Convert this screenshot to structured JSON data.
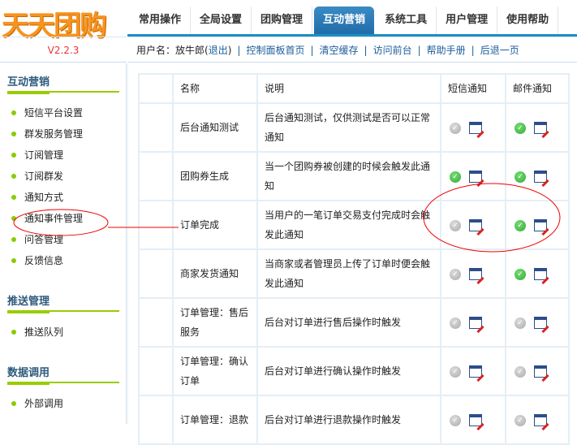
{
  "logo": "天天团购",
  "version": "V2.2.3",
  "nav": [
    "常用操作",
    "全局设置",
    "团购管理",
    "互动营销",
    "系统工具",
    "用户管理",
    "使用帮助"
  ],
  "active_tab": 3,
  "subbar": {
    "user_label": "用户名：放牛郎",
    "open": "(",
    "logout": "退出",
    "close": ")",
    "links": [
      "控制面板首页",
      "清空缓存",
      "访问前台",
      "帮助手册",
      "后退一页"
    ]
  },
  "sidebar": [
    {
      "title": "互动营销",
      "items": [
        "短信平台设置",
        "群发服务管理",
        "订阅管理",
        "订阅群发",
        "通知方式",
        "通知事件管理",
        "问答管理",
        "反馈信息"
      ]
    },
    {
      "title": "推送管理",
      "items": [
        "推送队列"
      ]
    },
    {
      "title": "数据调用",
      "items": [
        "外部调用"
      ]
    }
  ],
  "table": {
    "headers": [
      "",
      "名称",
      "说明",
      "短信通知",
      "邮件通知"
    ],
    "rows": [
      {
        "name": "后台通知测试",
        "desc": "后台通知测试，仅供测试是否可以正常通知",
        "sms": false,
        "email": true
      },
      {
        "name": "团购券生成",
        "desc": "当一个团购券被创建的时候会触发此通知",
        "sms": true,
        "email": true
      },
      {
        "name": "订单完成",
        "desc": "当用户的一笔订单交易支付完成时会触发此通知",
        "sms": false,
        "email": true
      },
      {
        "name": "商家发货通知",
        "desc": "当商家或者管理员上传了订单时便会触发此通知",
        "sms": false,
        "email": true
      },
      {
        "name": "订单管理：售后服务",
        "desc": "后台对订单进行售后操作时触发",
        "sms": false,
        "email": false
      },
      {
        "name": "订单管理：确认订单",
        "desc": "后台对订单进行确认操作时触发",
        "sms": false,
        "email": false
      },
      {
        "name": "订单管理：退款",
        "desc": "后台对订单进行退款操作时触发",
        "sms": false,
        "email": false
      }
    ]
  },
  "colors": {
    "accent": "#1a8fc6",
    "annotation": "#e00000",
    "green": "#99cc00"
  }
}
